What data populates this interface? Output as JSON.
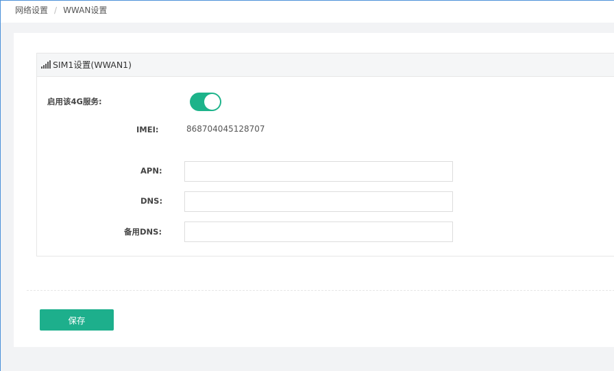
{
  "breadcrumb": {
    "parent": "网络设置",
    "separator": "/",
    "current": "WWAN设置"
  },
  "panel": {
    "icon": "signal-bars-icon",
    "title": "SIM1设置(WWAN1)"
  },
  "form": {
    "enable_label": "启用该4G服务:",
    "enable_state": true,
    "imei_label": "IMEI:",
    "imei_value": "868704045128707",
    "apn_label": "APN:",
    "apn_value": "",
    "dns_label": "DNS:",
    "dns_value": "",
    "backup_dns_label": "备用DNS:",
    "backup_dns_value": ""
  },
  "actions": {
    "save_label": "保存"
  },
  "colors": {
    "accent": "#1daf8c",
    "frame_border": "#4a90d9"
  }
}
